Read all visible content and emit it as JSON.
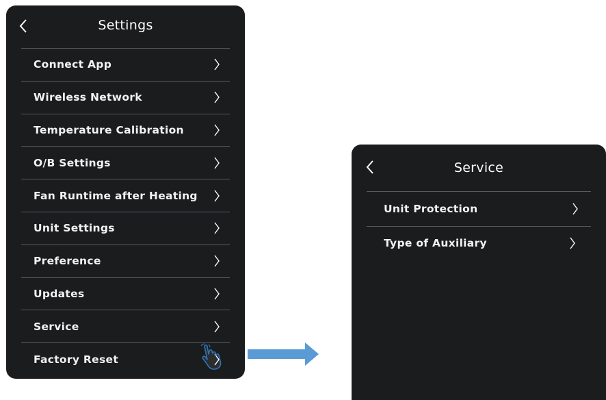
{
  "settings": {
    "title": "Settings",
    "items": [
      {
        "label": "Connect App"
      },
      {
        "label": "Wireless Network"
      },
      {
        "label": "Temperature Calibration"
      },
      {
        "label": "O/B Settings"
      },
      {
        "label": "Fan Runtime after Heating"
      },
      {
        "label": "Unit Settings"
      },
      {
        "label": "Preference"
      },
      {
        "label": "Updates"
      },
      {
        "label": "Service"
      },
      {
        "label": "Factory Reset"
      }
    ]
  },
  "service": {
    "title": "Service",
    "items": [
      {
        "label": "Unit Protection"
      },
      {
        "label": "Type of Auxiliary"
      }
    ]
  },
  "colors": {
    "screen_bg": "#1b1c1e",
    "divider": "#5a5b5e",
    "arrow": "#5b9bd5",
    "hand_outline": "#2e75b6"
  },
  "icons": {
    "back": "chevron-left-icon",
    "row": "chevron-right-icon",
    "pointer": "hand-pointer-icon",
    "flow": "right-arrow-icon"
  }
}
